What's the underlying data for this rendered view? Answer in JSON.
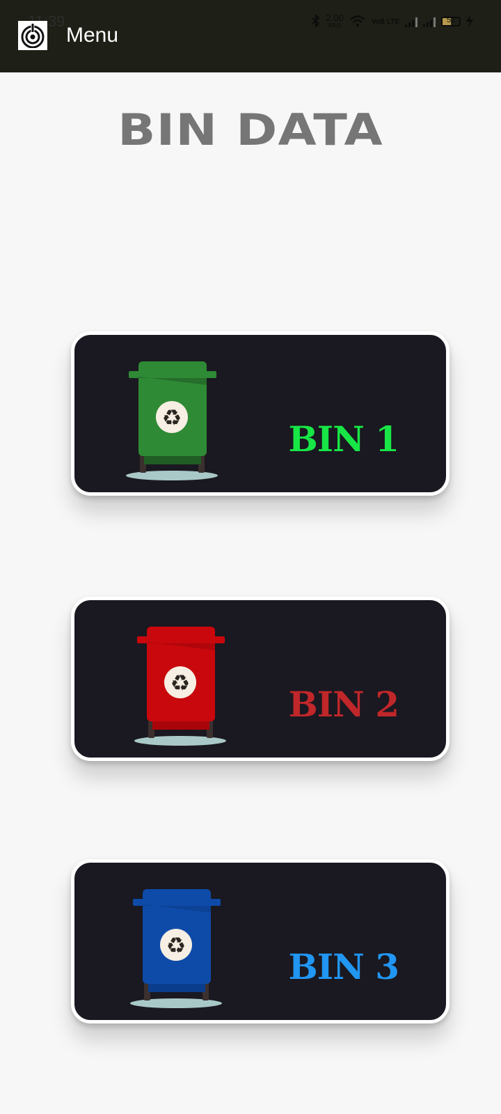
{
  "status_bar": {
    "time": "11:39",
    "net_speed": "2.00",
    "net_unit": "KB/S",
    "volte": "VoB LTE",
    "battery": "51"
  },
  "app_bar": {
    "title": "Menu",
    "logo_icon": "target-power-icon"
  },
  "page_title": "BIN DATA",
  "bins": [
    {
      "label": "BIN 1",
      "label_color": "#17e646",
      "bin_color": "#2e8a35",
      "icon": "green-recycle-bin-icon"
    },
    {
      "label": "BIN 2",
      "label_color": "#c0272a",
      "bin_color": "#c8080d",
      "icon": "red-recycle-bin-icon"
    },
    {
      "label": "BIN 3",
      "label_color": "#2196f3",
      "bin_color": "#0e4ba8",
      "icon": "blue-recycle-bin-icon"
    }
  ]
}
